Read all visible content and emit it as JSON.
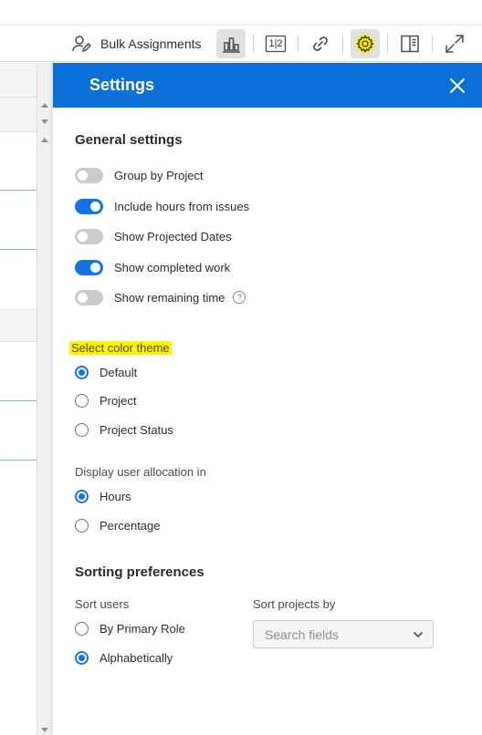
{
  "toolbar": {
    "bulk_assignments_label": "Bulk Assignments",
    "icons": [
      "person-edit-icon",
      "bar-chart-icon",
      "split-view-icon",
      "link-icon",
      "gear-icon",
      "side-panel-icon",
      "expand-icon"
    ],
    "split_label": "1|2",
    "active_color": "#e1e1e1",
    "gear_highlight": "#fff200"
  },
  "panel": {
    "title": "Settings",
    "header_color": "#0b71d9",
    "general": {
      "title": "General settings",
      "toggles": [
        {
          "label": "Group by Project",
          "on": false
        },
        {
          "label": "Include hours from issues",
          "on": true
        },
        {
          "label": "Show Projected Dates",
          "on": false
        },
        {
          "label": "Show completed work",
          "on": true
        },
        {
          "label": "Show remaining time",
          "on": false
        }
      ],
      "help_glyph": "?"
    },
    "color_theme": {
      "label": "Select color theme",
      "options": [
        {
          "label": "Default",
          "checked": true
        },
        {
          "label": "Project",
          "checked": false
        },
        {
          "label": "Project Status",
          "checked": false
        }
      ]
    },
    "allocation": {
      "label": "Display user allocation in",
      "options": [
        {
          "label": "Hours",
          "checked": true
        },
        {
          "label": "Percentage",
          "checked": false
        }
      ]
    },
    "sorting": {
      "title": "Sorting preferences",
      "sort_users_label": "Sort users",
      "sort_users_options": [
        {
          "label": "By Primary Role",
          "checked": false
        },
        {
          "label": "Alphabetically",
          "checked": true
        }
      ],
      "sort_projects_label": "Sort projects by",
      "search_placeholder": "Search fields"
    }
  }
}
